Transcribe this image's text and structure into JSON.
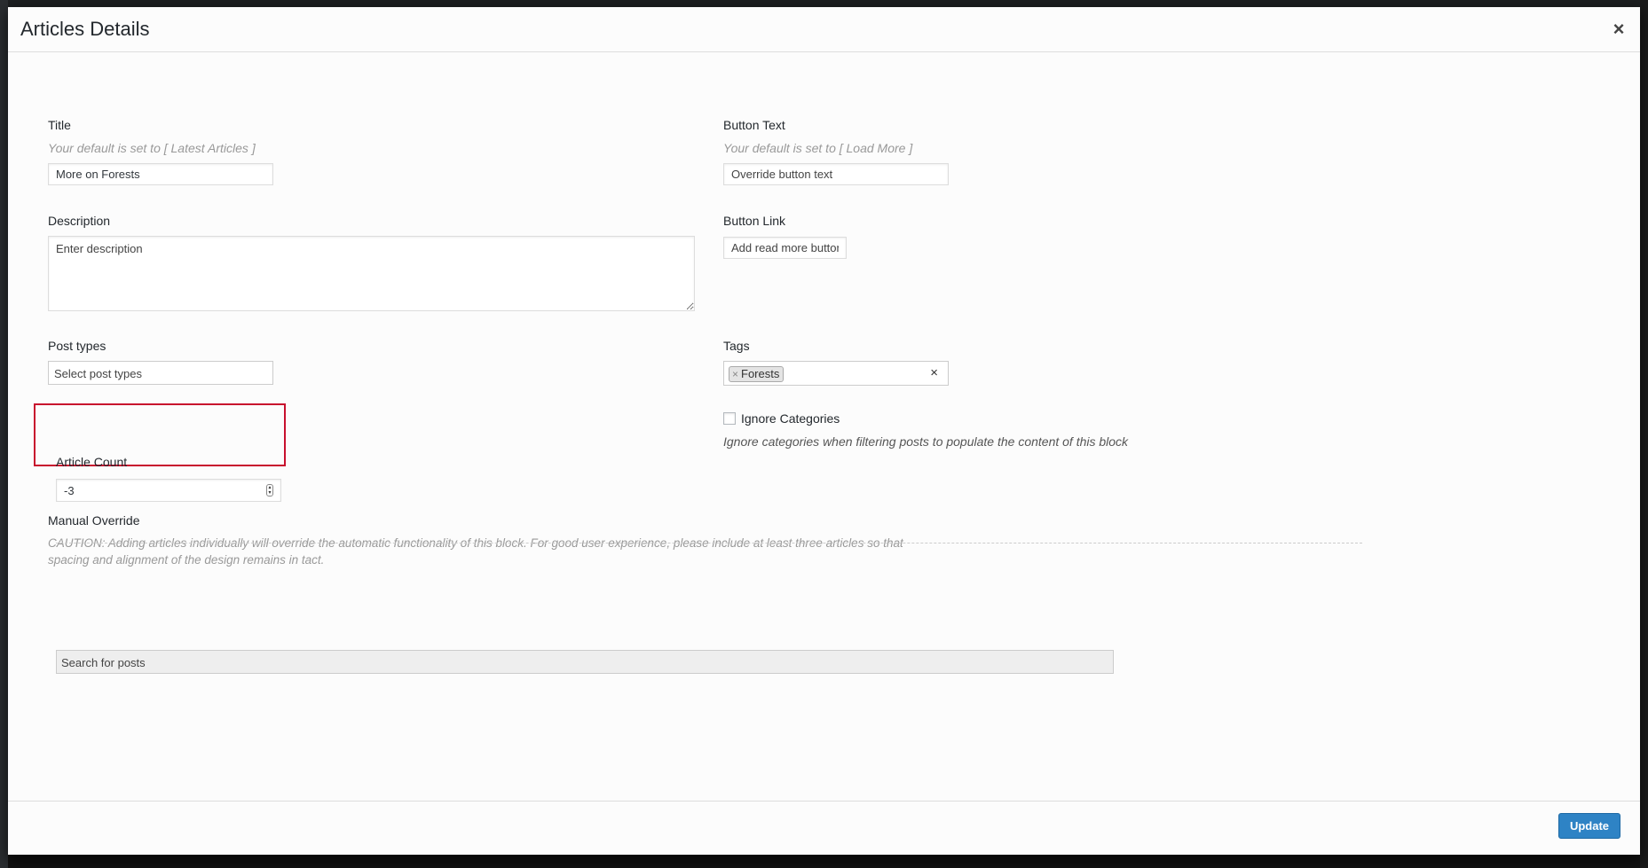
{
  "modal": {
    "title": "Articles Details",
    "close_icon": "close-icon"
  },
  "title_field": {
    "label": "Title",
    "hint": "Your default is set to [ Latest Articles ]",
    "value": "More on Forests"
  },
  "button_text_field": {
    "label": "Button Text",
    "hint": "Your default is set to [ Load More ]",
    "placeholder": "Override button text"
  },
  "description_field": {
    "label": "Description",
    "placeholder": "Enter description"
  },
  "button_link_field": {
    "label": "Button Link",
    "placeholder": "Add read more button link"
  },
  "post_types_field": {
    "label": "Post types",
    "placeholder": "Select post types"
  },
  "tags_field": {
    "label": "Tags",
    "tags": [
      "Forests"
    ],
    "tag_remove_glyph": "×",
    "clear_glyph": "×"
  },
  "article_count_field": {
    "label": "Article Count",
    "value": "-3",
    "highlight_color": "#c8102e"
  },
  "ignore_categories": {
    "label": "Ignore Categories",
    "checked": false,
    "description": "Ignore categories when filtering posts to populate the content of this block"
  },
  "manual_override": {
    "label": "Manual Override",
    "caution_line1": "CAUTION: Adding articles individually will override the automatic functionality of this block. For good user experience, please include at least three articles so that",
    "caution_line2": "spacing and alignment of the design remains in tact.",
    "search_placeholder": "Search for posts"
  },
  "footer": {
    "update_label": "Update",
    "accent_color": "#2e83c5"
  }
}
